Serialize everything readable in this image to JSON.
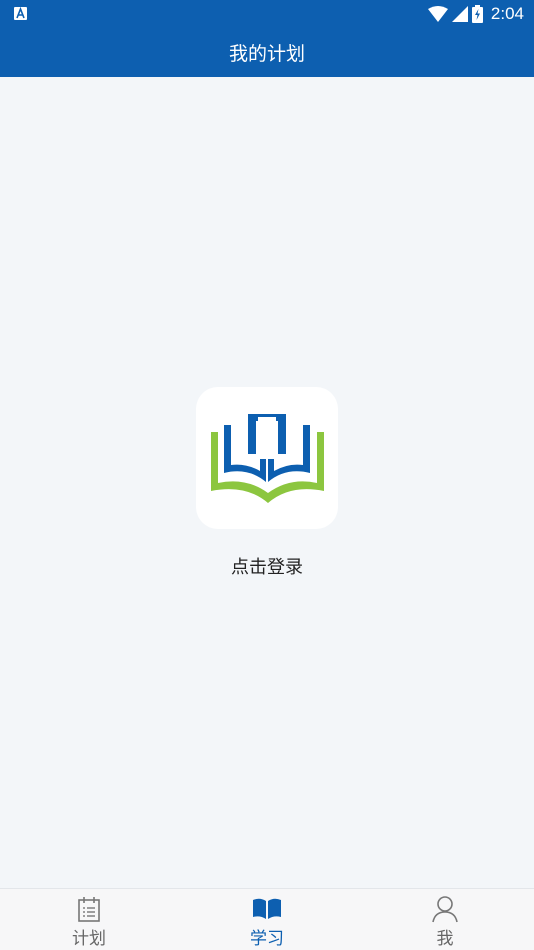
{
  "status_bar": {
    "time": "2:04",
    "icons": [
      "notification-a-icon",
      "wifi-icon",
      "signal-icon",
      "battery-charging-icon"
    ]
  },
  "header": {
    "title": "我的计划"
  },
  "main": {
    "login_label": "点击登录",
    "logo_icon": "open-book-logo-icon"
  },
  "tabbar": {
    "tabs": [
      {
        "label": "计划",
        "icon": "calendar-icon",
        "active": false
      },
      {
        "label": "学习",
        "icon": "book-icon",
        "active": true
      },
      {
        "label": "我",
        "icon": "person-icon",
        "active": false
      }
    ]
  },
  "colors": {
    "primary": "#0d5fb0",
    "accent_green": "#8cc63f",
    "background": "#f3f6f9",
    "inactive_tab": "#666666"
  }
}
